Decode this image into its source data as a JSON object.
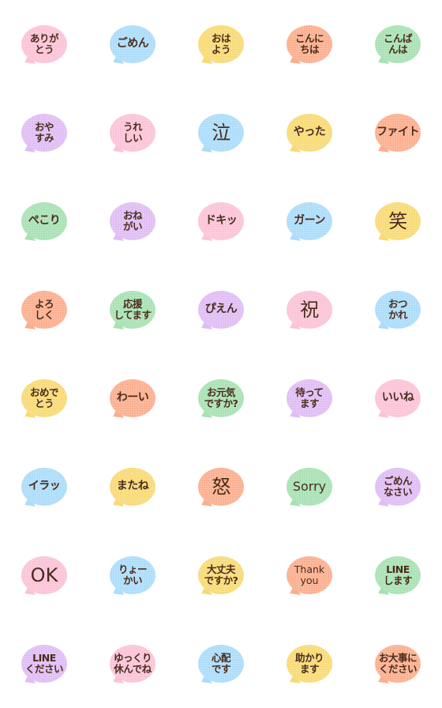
{
  "colors": {
    "pink": "#fbc3d6",
    "blue": "#abdcfa",
    "yellow": "#f8da75",
    "orange": "#fbae8d",
    "green": "#a8e1b3",
    "purple": "#dfbdf4",
    "text": "#4a2c1c",
    "background": "#ffffff"
  },
  "stickers": [
    {
      "text": "ありが\nとう",
      "color": "pink",
      "style": "two"
    },
    {
      "text": "ごめん",
      "color": "blue",
      "style": "one"
    },
    {
      "text": "おは\nよう",
      "color": "yellow",
      "style": "two"
    },
    {
      "text": "こんに\nちは",
      "color": "orange",
      "style": "two"
    },
    {
      "text": "こんば\nんは",
      "color": "green",
      "style": "two"
    },
    {
      "text": "おや\nすみ",
      "color": "purple",
      "style": "two"
    },
    {
      "text": "うれ\nしい",
      "color": "pink",
      "style": "two"
    },
    {
      "text": "泣",
      "color": "blue",
      "style": "big"
    },
    {
      "text": "やった",
      "color": "yellow",
      "style": "one"
    },
    {
      "text": "ファイト",
      "color": "orange",
      "style": "one"
    },
    {
      "text": "ぺこり",
      "color": "green",
      "style": "one"
    },
    {
      "text": "おね\nがい",
      "color": "purple",
      "style": "two"
    },
    {
      "text": "ドキッ",
      "color": "pink",
      "style": "one"
    },
    {
      "text": "ガーン",
      "color": "blue",
      "style": "one"
    },
    {
      "text": "笑",
      "color": "yellow",
      "style": "big"
    },
    {
      "text": "よろ\nしく",
      "color": "orange",
      "style": "two"
    },
    {
      "text": "応援\nしてます",
      "color": "green",
      "style": "two"
    },
    {
      "text": "ぴえん",
      "color": "purple",
      "style": "one"
    },
    {
      "text": "祝",
      "color": "pink",
      "style": "big"
    },
    {
      "text": "おつ\nかれ",
      "color": "blue",
      "style": "two"
    },
    {
      "text": "おめで\nとう",
      "color": "yellow",
      "style": "two"
    },
    {
      "text": "わーい",
      "color": "orange",
      "style": "one"
    },
    {
      "text": "お元気\nですか?",
      "color": "green",
      "style": "two"
    },
    {
      "text": "待って\nます",
      "color": "purple",
      "style": "two"
    },
    {
      "text": "いいね",
      "color": "pink",
      "style": "one"
    },
    {
      "text": "イラッ",
      "color": "blue",
      "style": "one"
    },
    {
      "text": "またね",
      "color": "yellow",
      "style": "one"
    },
    {
      "text": "怒",
      "color": "orange",
      "style": "big"
    },
    {
      "text": "Sorry",
      "color": "green",
      "style": "en"
    },
    {
      "text": "ごめん\nなさい",
      "color": "purple",
      "style": "two"
    },
    {
      "text": "OK",
      "color": "pink",
      "style": "en-ok"
    },
    {
      "text": "りょー\nかい",
      "color": "blue",
      "style": "two"
    },
    {
      "text": "大丈夫\nですか?",
      "color": "yellow",
      "style": "two"
    },
    {
      "text": "Thank\nyou",
      "color": "orange",
      "style": "en-small"
    },
    {
      "text": "LINE\nします",
      "color": "green",
      "style": "two"
    },
    {
      "text": "LINE\nください",
      "color": "purple",
      "style": "two"
    },
    {
      "text": "ゆっくり\n休んでね",
      "color": "pink",
      "style": "two"
    },
    {
      "text": "心配\nです",
      "color": "blue",
      "style": "two"
    },
    {
      "text": "助かり\nます",
      "color": "yellow",
      "style": "two"
    },
    {
      "text": "お大事に\nください",
      "color": "orange",
      "style": "two"
    }
  ]
}
